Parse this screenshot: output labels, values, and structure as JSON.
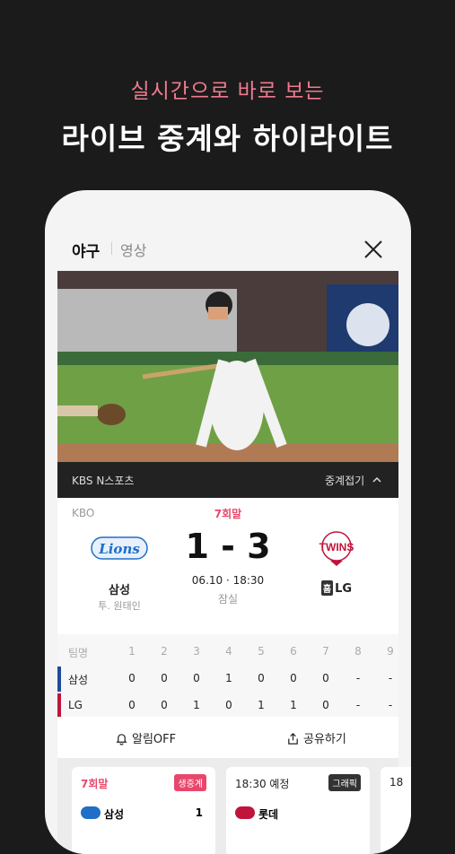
{
  "promo": {
    "subtitle": "실시간으로 바로 보는",
    "title": "라이브 중계와 하이라이트"
  },
  "header": {
    "tabs": [
      "야구",
      "영상"
    ]
  },
  "broadcast": {
    "channel": "KBS N스포츠",
    "fold_label": "중계접기"
  },
  "game": {
    "league": "KBO",
    "inning": "7회말",
    "score": "1 - 3",
    "datetime": "06.10 · 18:30",
    "stadium": "잠실",
    "away": {
      "name": "삼성",
      "logo_text": "Lions",
      "pitcher": "투. 원태인"
    },
    "home": {
      "name": "LG",
      "logo_text": "TWINS",
      "home_badge": "홈"
    }
  },
  "boxscore": {
    "header_label": "팀명",
    "innings": [
      "1",
      "2",
      "3",
      "4",
      "5",
      "6",
      "7",
      "8",
      "9"
    ],
    "rows": [
      {
        "team": "삼성",
        "values": [
          "0",
          "0",
          "0",
          "1",
          "0",
          "0",
          "0",
          "-",
          "-"
        ]
      },
      {
        "team": "LG",
        "values": [
          "0",
          "0",
          "1",
          "0",
          "1",
          "1",
          "0",
          "-",
          "-"
        ]
      }
    ]
  },
  "actions": {
    "alarm": "알림OFF",
    "share": "공유하기"
  },
  "mini_cards": [
    {
      "label": "7회말",
      "badge": "생중계",
      "badge_color": "#e8476b",
      "team": "삼성",
      "score": "1"
    },
    {
      "label": "18:30 예정",
      "badge": "그래픽",
      "badge_color": "#333333",
      "team": "롯데",
      "score": ""
    },
    {
      "label": "18",
      "badge": "",
      "badge_color": "#ffffff",
      "team": "",
      "score": ""
    }
  ],
  "colors": {
    "accent": "#e8476b",
    "background": "#1b1b1b"
  }
}
